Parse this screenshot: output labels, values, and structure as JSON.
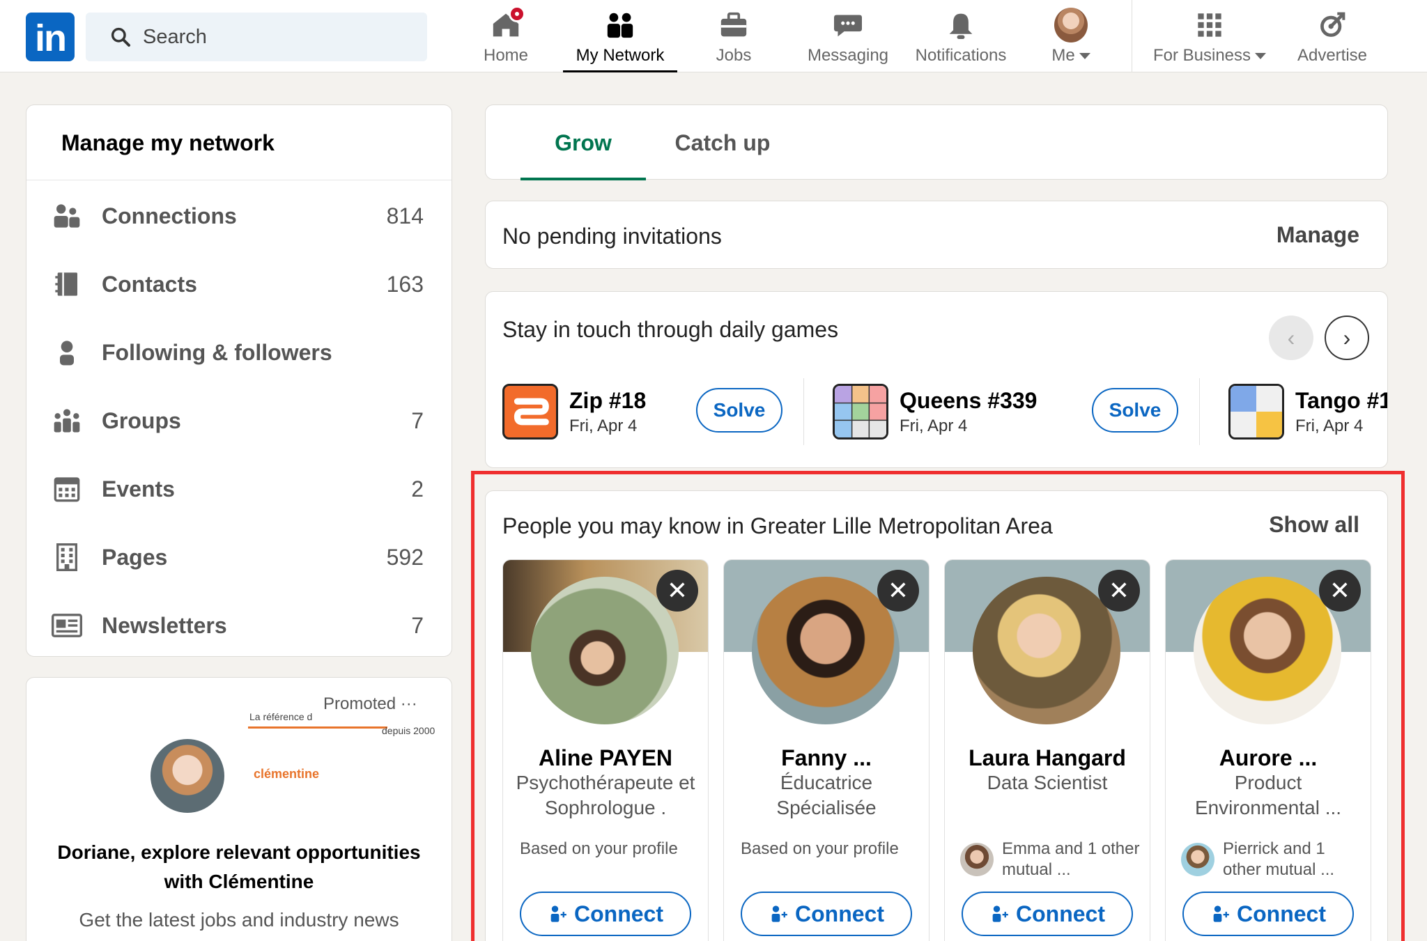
{
  "nav": {
    "search_placeholder": "Search",
    "items": [
      {
        "label": "Home"
      },
      {
        "label": "My Network"
      },
      {
        "label": "Jobs"
      },
      {
        "label": "Messaging"
      },
      {
        "label": "Notifications"
      },
      {
        "label": "Me"
      },
      {
        "label": "For Business"
      },
      {
        "label": "Advertise"
      }
    ],
    "active": "My Network"
  },
  "manage": {
    "title": "Manage my network",
    "items": [
      {
        "label": "Connections",
        "count": "814",
        "icon": "people-icon"
      },
      {
        "label": "Contacts",
        "count": "163",
        "icon": "contact-book-icon"
      },
      {
        "label": "Following & followers",
        "count": "",
        "icon": "person-icon"
      },
      {
        "label": "Groups",
        "count": "7",
        "icon": "groups-icon"
      },
      {
        "label": "Events",
        "count": "2",
        "icon": "calendar-icon"
      },
      {
        "label": "Pages",
        "count": "592",
        "icon": "building-icon"
      },
      {
        "label": "Newsletters",
        "count": "7",
        "icon": "newspaper-icon"
      }
    ]
  },
  "promo": {
    "promoted": "Promoted ···",
    "brand_small": "La référence d",
    "brand_small2": "depuis 2000",
    "brand": "clémentine",
    "headline": "Doriane, explore relevant opportunities with Clémentine",
    "sub": "Get the latest jobs and industry news"
  },
  "tabs": [
    {
      "label": "Grow"
    },
    {
      "label": "Catch up"
    }
  ],
  "invitations": {
    "text": "No pending invitations",
    "manage": "Manage"
  },
  "games": {
    "title": "Stay in touch through daily games",
    "items": [
      {
        "name": "Zip #18",
        "date": "Fri, Apr 4",
        "action": "Solve"
      },
      {
        "name": "Queens #339",
        "date": "Fri, Apr 4",
        "action": "Solve"
      },
      {
        "name": "Tango #1",
        "date": "Fri, Apr 4"
      }
    ]
  },
  "pymk": {
    "title": "People you may know in Greater Lille Metropolitan Area",
    "show_all": "Show all",
    "people": [
      {
        "name": "Aline PAYEN",
        "desc": "Psychothérapeute et Sophrologue .",
        "reason": "Based on your profile",
        "action": "Connect"
      },
      {
        "name": "Fanny ...",
        "desc": "Éducatrice Spécialisée",
        "reason": "Based on your profile",
        "action": "Connect"
      },
      {
        "name": "Laura Hangard",
        "desc": "Data Scientist",
        "reason": "Emma and 1 other mutual ...",
        "action": "Connect"
      },
      {
        "name": "Aurore ...",
        "desc": "Product Environmental ...",
        "reason": "Pierrick and 1 other mutual ...",
        "action": "Connect"
      }
    ]
  },
  "colors": {
    "brand": "#0a66c2",
    "accent_green": "#01754f",
    "highlight": "#ef2f2f"
  }
}
